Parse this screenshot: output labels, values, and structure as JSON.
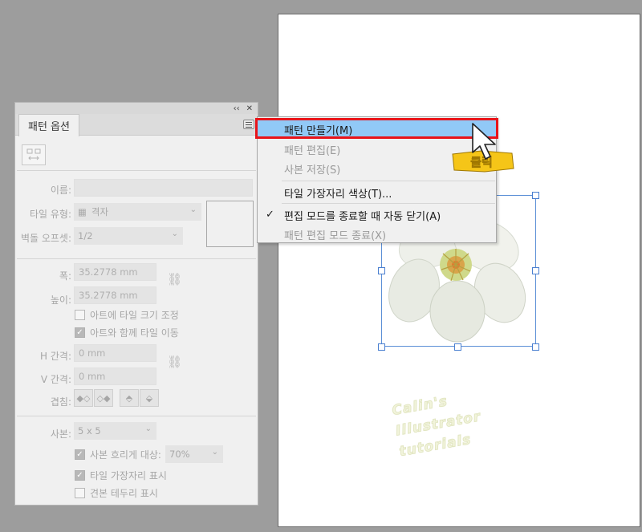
{
  "panel": {
    "title": "패턴 옵션",
    "collapse_glyph": "‹‹",
    "close_glyph": "✕",
    "name_label": "이름:",
    "name_value": "",
    "tile_type_label": "타일 유형:",
    "tile_type_value": "격자",
    "brick_offset_label": "벽돌 오프셋:",
    "brick_offset_value": "1/2",
    "width_label": "폭:",
    "width_value": "35.2778 mm",
    "height_label": "높이:",
    "height_value": "35.2778 mm",
    "size_tile_to_art": "아트에 타일 크기 조정",
    "size_tile_to_art_checked": false,
    "move_tile_with_art": "아트와 함께 타일 이동",
    "move_tile_with_art_checked": true,
    "h_spacing_label": "H 간격:",
    "h_spacing_value": "0 mm",
    "v_spacing_label": "V 간격:",
    "v_spacing_value": "0 mm",
    "overlap_label": "겹침:",
    "copies_label": "사본:",
    "copies_value": "5 x 5",
    "dim_copies_to": "사본 흐리게 대상:",
    "dim_copies_checked": true,
    "dim_copies_value": "70%",
    "show_tile_edge": "타일 가장자리 표시",
    "show_tile_edge_checked": true,
    "show_swatch_bounds": "견본 테두리 표시",
    "show_swatch_bounds_checked": false
  },
  "menu": {
    "items": [
      {
        "label": "패턴 만들기(M)",
        "enabled": true,
        "highlighted": true
      },
      {
        "label": "패턴 편집(E)",
        "enabled": false
      },
      {
        "label": "사본 저장(S)",
        "enabled": false
      },
      {
        "label": "타일 가장자리 색상(T)...",
        "enabled": true
      },
      {
        "label": "편집 모드를 종료할 때 자동 닫기(A)",
        "enabled": true,
        "checked": true
      },
      {
        "label": "패턴 편집 모드 종료(X)",
        "enabled": false
      }
    ]
  },
  "annotation": {
    "click_label": "클릭",
    "colors": {
      "highlight_box": "#e8141a",
      "click_label": "#f5c518"
    }
  },
  "watermark": {
    "lines": [
      "Calin's",
      "Illustrator",
      "tutorials"
    ]
  },
  "colors": {
    "menu_highlight": "#91c9f7",
    "selection": "#4a7fd0"
  }
}
